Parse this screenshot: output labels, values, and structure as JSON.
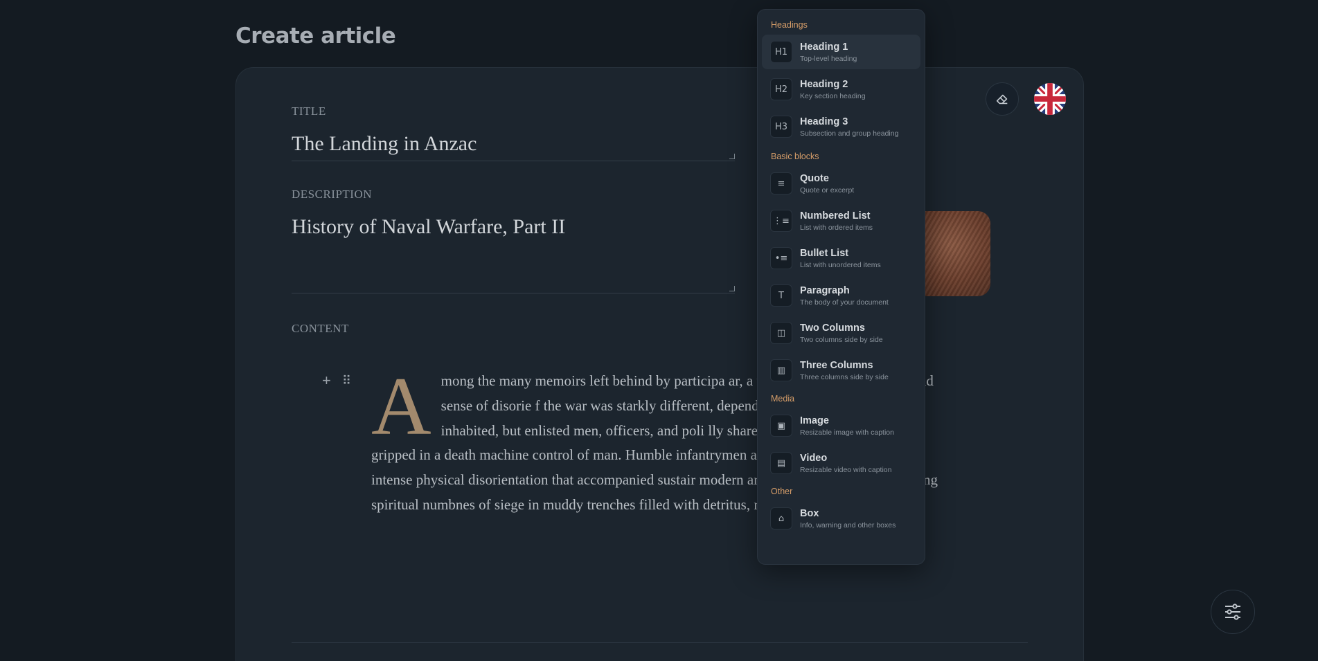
{
  "page": {
    "title": "Create article"
  },
  "form": {
    "title_label": "TITLE",
    "title_value": "The Landing in Anzac",
    "description_label": "DESCRIPTION",
    "description_value": "History of Naval Warfare, Part II",
    "content_label": "CONTENT"
  },
  "editor": {
    "add_symbol": "+",
    "drag_symbol": "⠿",
    "dropcap": "A",
    "paragraph": "mong the many memoirs left behind by participa ar, a ubiquitous motif is a profound sense of disorie f the war was starkly different, depending on wha hierarchy one inhabited, but enlisted men, officers, and poli lly shared a sense that Europe was gripped in a death machine control of man. Humble infantrymen at the front experienc n the intense physical disorientation that accompanied sustair modern artillery, and also in the creeping spiritual numbnes of siege in muddy trenches filled with detritus, rats, and corpses./"
  },
  "toolbar": {
    "clear_icon": "eraser-icon",
    "language_icon": "uk-flag-icon",
    "settings_icon": "sliders-icon"
  },
  "menu": {
    "sections": [
      {
        "title": "Headings",
        "items": [
          {
            "icon": "H1",
            "label": "Heading 1",
            "desc": "Top-level heading"
          },
          {
            "icon": "H2",
            "label": "Heading 2",
            "desc": "Key section heading"
          },
          {
            "icon": "H3",
            "label": "Heading 3",
            "desc": "Subsection and group heading"
          }
        ]
      },
      {
        "title": "Basic blocks",
        "items": [
          {
            "icon": "≡",
            "label": "Quote",
            "desc": "Quote or excerpt"
          },
          {
            "icon": "⋮≡",
            "label": "Numbered List",
            "desc": "List with ordered items"
          },
          {
            "icon": "•≡",
            "label": "Bullet List",
            "desc": "List with unordered items"
          },
          {
            "icon": "T",
            "label": "Paragraph",
            "desc": "The body of your document"
          },
          {
            "icon": "◫",
            "label": "Two Columns",
            "desc": "Two columns side by side"
          },
          {
            "icon": "▥",
            "label": "Three Columns",
            "desc": "Three columns side by side"
          }
        ]
      },
      {
        "title": "Media",
        "items": [
          {
            "icon": "▣",
            "label": "Image",
            "desc": "Resizable image with caption"
          },
          {
            "icon": "▤",
            "label": "Video",
            "desc": "Resizable video with caption"
          }
        ]
      },
      {
        "title": "Other",
        "items": [
          {
            "icon": "⌂",
            "label": "Box",
            "desc": "Info, warning and other boxes"
          }
        ]
      }
    ]
  }
}
